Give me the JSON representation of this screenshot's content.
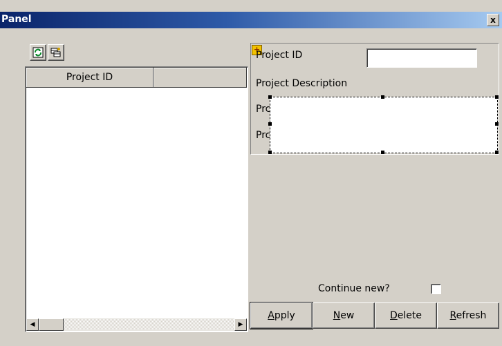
{
  "window": {
    "title": "Panel",
    "close_glyph": "x"
  },
  "toolbar": {
    "refresh_icon": "refresh-icon",
    "add_icon": "add-row-icon"
  },
  "grid": {
    "columns": [
      "Project ID",
      ""
    ],
    "rows": []
  },
  "form": {
    "project_id_label": "Project ID",
    "project_id_value": "",
    "project_description_label": "Project Description",
    "row3_label_partial": "Prc",
    "row4_label_partial": "Prc",
    "continue_new_label": "Continue new?",
    "continue_new_checked": false
  },
  "buttons": {
    "apply": {
      "mnemonic": "A",
      "rest": "pply"
    },
    "new": {
      "mnemonic": "N",
      "rest": "ew"
    },
    "delete": {
      "mnemonic": "D",
      "rest": "elete"
    },
    "refresh": {
      "mnemonic": "R",
      "rest": "efresh"
    }
  },
  "colors": {
    "titlebar_start": "#0a246a",
    "titlebar_end": "#a6caf0",
    "face": "#d4d0c8"
  }
}
